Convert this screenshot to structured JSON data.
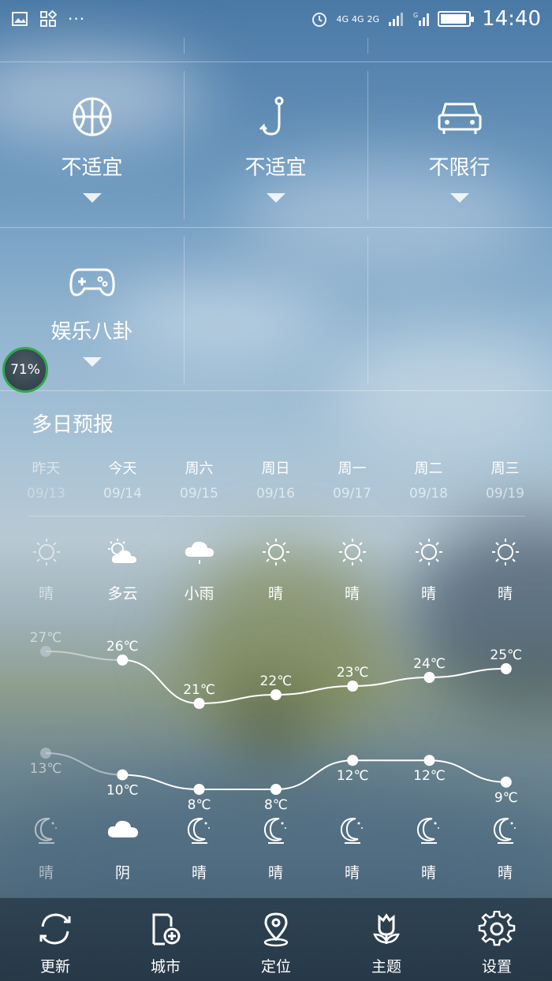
{
  "status_bar": {
    "time": "14:40",
    "network_labels": [
      "4G",
      "4G",
      "2G"
    ],
    "icons": [
      "image-icon",
      "app-grid-icon",
      "more-dots-icon",
      "alarm-icon",
      "signal-icon",
      "signal-g-icon",
      "battery-icon"
    ],
    "battery_level": 0.95
  },
  "indices": [
    {
      "icon": "basketball-icon",
      "label": "不适宜"
    },
    {
      "icon": "fishing-hook-icon",
      "label": "不适宜"
    },
    {
      "icon": "car-icon",
      "label": "不限行"
    },
    {
      "icon": "gamepad-icon",
      "label": "娱乐八卦"
    }
  ],
  "bubble": {
    "text": "71%"
  },
  "forecast": {
    "title": "多日预报",
    "days": [
      {
        "name": "昨天",
        "date": "09/13",
        "day_weather": "晴",
        "day_icon": "sun-icon",
        "night_weather": "晴",
        "night_icon": "moon-icon",
        "high": "27℃",
        "low": "13℃",
        "high_value": 27,
        "low_value": 13
      },
      {
        "name": "今天",
        "date": "09/14",
        "day_weather": "多云",
        "day_icon": "partly-cloudy-icon",
        "night_weather": "阴",
        "night_icon": "cloud-icon",
        "high": "26℃",
        "low": "10℃",
        "high_value": 26,
        "low_value": 10
      },
      {
        "name": "周六",
        "date": "09/15",
        "day_weather": "小雨",
        "day_icon": "light-rain-icon",
        "night_weather": "晴",
        "night_icon": "moon-icon",
        "high": "21℃",
        "low": "8℃",
        "high_value": 21,
        "low_value": 8
      },
      {
        "name": "周日",
        "date": "09/16",
        "day_weather": "晴",
        "day_icon": "sun-icon",
        "night_weather": "晴",
        "night_icon": "moon-icon",
        "high": "22℃",
        "low": "8℃",
        "high_value": 22,
        "low_value": 8
      },
      {
        "name": "周一",
        "date": "09/17",
        "day_weather": "晴",
        "day_icon": "sun-icon",
        "night_weather": "晴",
        "night_icon": "moon-icon",
        "high": "23℃",
        "low": "12℃",
        "high_value": 23,
        "low_value": 12
      },
      {
        "name": "周二",
        "date": "09/18",
        "day_weather": "晴",
        "day_icon": "sun-icon",
        "night_weather": "晴",
        "night_icon": "moon-icon",
        "high": "24℃",
        "low": "12℃",
        "high_value": 24,
        "low_value": 12
      },
      {
        "name": "周三",
        "date": "09/19",
        "day_weather": "晴",
        "day_icon": "sun-icon",
        "night_weather": "晴",
        "night_icon": "moon-icon",
        "high": "25℃",
        "low": "9℃",
        "high_value": 25,
        "low_value": 9
      }
    ]
  },
  "nav": [
    {
      "icon": "refresh-icon",
      "label": "更新"
    },
    {
      "icon": "city-icon",
      "label": "城市"
    },
    {
      "icon": "location-pin-icon",
      "label": "定位"
    },
    {
      "icon": "theme-flower-icon",
      "label": "主题"
    },
    {
      "icon": "gear-icon",
      "label": "设置"
    }
  ]
}
